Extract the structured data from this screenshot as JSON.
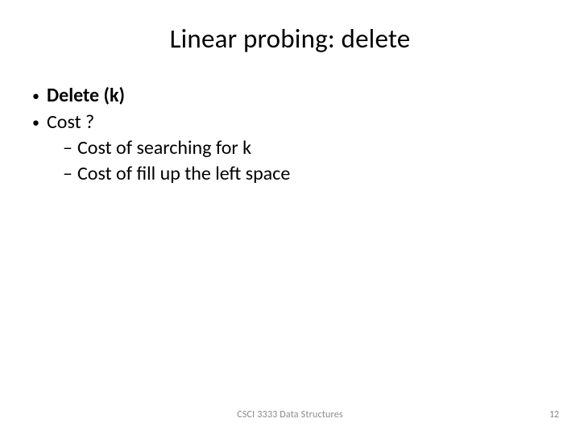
{
  "slide": {
    "title": "Linear probing: delete",
    "bullets": {
      "l1a": "Delete (k)",
      "l1b": "Cost ?",
      "l2a": "Cost of searching for k",
      "l2b": "Cost of fill up the left space"
    },
    "footer": {
      "course": "CSCI 3333 Data Structures",
      "page": "12"
    }
  }
}
